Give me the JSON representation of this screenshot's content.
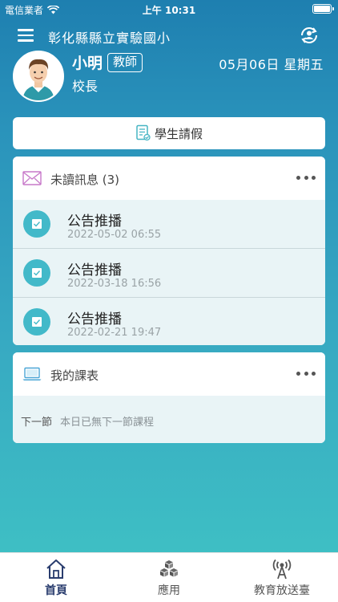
{
  "status_bar": {
    "carrier": "電信業者",
    "time": "上午 10:31"
  },
  "header": {
    "school_name": "彰化縣縣立實驗國小",
    "user_name": "小明",
    "role_badge": "教師",
    "user_title": "校長",
    "date": "05月06日 星期五"
  },
  "leave_button": {
    "label": "學生請假"
  },
  "messages_card": {
    "title": "未讀訊息 (3)",
    "items": [
      {
        "title": "公告推播",
        "date": "2022-05-02 06:55"
      },
      {
        "title": "公告推播",
        "date": "2022-03-18 16:56"
      },
      {
        "title": "公告推播",
        "date": "2022-02-21 19:47"
      }
    ]
  },
  "schedule_card": {
    "title": "我的課表",
    "next_label": "下一節",
    "next_text": "本日已無下一節課程"
  },
  "tab_bar": {
    "tabs": [
      {
        "label": "首頁",
        "icon": "home-icon",
        "active": true
      },
      {
        "label": "應用",
        "icon": "cubes-icon"
      },
      {
        "label": "教育放送臺",
        "icon": "broadcast-tower-icon"
      }
    ]
  },
  "colors": {
    "header_blue": "#1e7fb0",
    "gradient_bottom": "#3ebfc4",
    "message_icon": "#42b9c9",
    "row_background": "#e9f4f6",
    "active_tab": "#2a3d6e"
  }
}
